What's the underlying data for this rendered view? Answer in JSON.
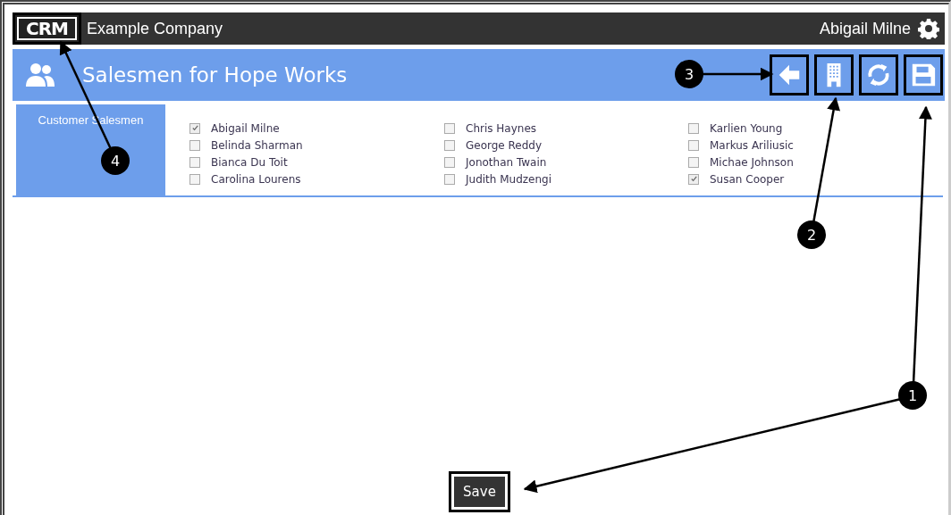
{
  "topbar": {
    "logo": "CRM",
    "logo_highlighted": true,
    "company": "Example Company",
    "user": "Abigail Milne"
  },
  "header": {
    "title": "Salesmen for Hope Works",
    "tools": [
      {
        "kind": "back",
        "highlighted": true
      },
      {
        "kind": "building",
        "highlighted": true
      },
      {
        "kind": "refresh",
        "highlighted": true
      },
      {
        "kind": "save",
        "highlighted": true
      }
    ]
  },
  "section": {
    "label": "Customer Salesmen",
    "columns": [
      [
        {
          "name": "Abigail Milne",
          "checked": true
        },
        {
          "name": "Belinda Sharman",
          "checked": false
        },
        {
          "name": "Bianca Du Toit",
          "checked": false
        },
        {
          "name": "Carolina Lourens",
          "checked": false
        }
      ],
      [
        {
          "name": "Chris Haynes",
          "checked": false
        },
        {
          "name": "George Reddy",
          "checked": false
        },
        {
          "name": "Jonothan Twain",
          "checked": false
        },
        {
          "name": "Judith Mudzengi",
          "checked": false
        }
      ],
      [
        {
          "name": "Karlien Young",
          "checked": false
        },
        {
          "name": "Markus Ariliusic",
          "checked": false
        },
        {
          "name": "Michae Johnson",
          "checked": false
        },
        {
          "name": "Susan Cooper",
          "checked": true
        }
      ]
    ]
  },
  "save_button": {
    "label": "Save",
    "highlighted": true
  },
  "callouts": [
    {
      "number": "1"
    },
    {
      "number": "2"
    },
    {
      "number": "3"
    },
    {
      "number": "4"
    }
  ]
}
